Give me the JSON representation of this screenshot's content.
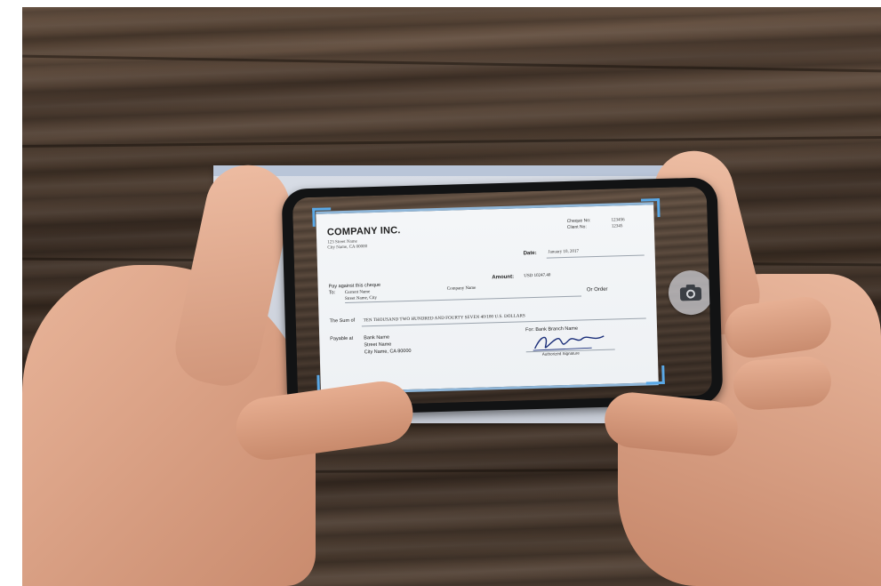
{
  "cheque": {
    "company_name": "COMPANY INC.",
    "company_address_line1": "123 Street Name",
    "company_address_line2": "City Name, CA 00000",
    "cheque_no_label": "Cheque No:",
    "cheque_no_value": "123456",
    "client_no_label": "Client No:",
    "client_no_value": "12345",
    "date_label": "Date:",
    "date_value": "January 10, 2017",
    "pay_against_label": "Pay against this cheque",
    "to_label": "To:",
    "payee_name": "Current Name",
    "payee_address": "Street Name, City",
    "company_name_mid": "Company Name",
    "amount_label": "Amount:",
    "amount_value": "USD 10247.40",
    "or_order_label": "Or Order",
    "sum_label": "The Sum of",
    "sum_value": "TEN THOUSAND TWO HUNDRED AND FOURTY SEVEN 40/100 U.S. DOLLARS",
    "payable_label": "Payable at",
    "bank_name": "Bank Name",
    "bank_street": "Street Name",
    "bank_city": "City Name, CA 80000",
    "for_label": "For: Bank Branch Name",
    "authorized_label": "Authorized Signature"
  },
  "camera": {
    "icon": "camera-icon"
  },
  "colors": {
    "scan_frame": "#5aa8e6",
    "phone_body": "#121314"
  }
}
